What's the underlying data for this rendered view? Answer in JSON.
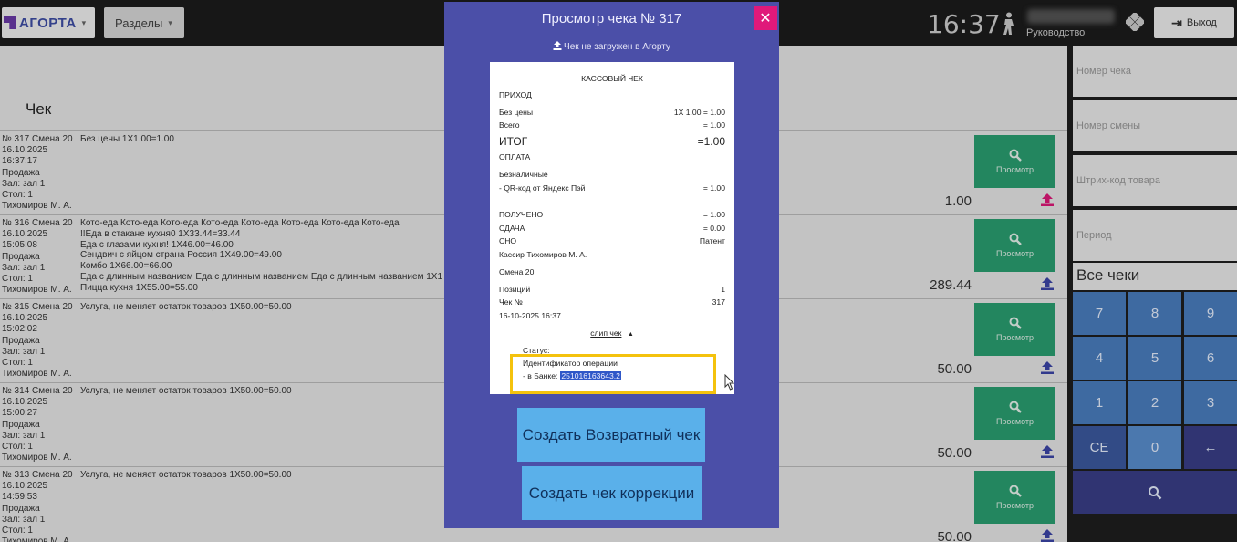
{
  "topbar": {
    "logo_text": "АГОРТА",
    "sections_label": "Разделы",
    "time": "16:37",
    "role": "Руководство",
    "exit_label": "Выход"
  },
  "page": {
    "title": "Чек"
  },
  "rows": [
    {
      "meta": "№ 317 Смена 20\n16.10.2025\n16:37:17\nПродажа\nЗал: зал 1\nСтол: 1\nТихомиров М. А.",
      "items": [
        "Без цены 1X1.00=1.00"
      ],
      "amount": "1.00",
      "view_label": "Просмотр",
      "upload_color": "#e0197a"
    },
    {
      "meta": "№ 316 Смена 20\n16.10.2025\n15:05:08\nПродажа\nЗал: зал 1\nСтол: 1\nТихомиров М. А.",
      "items": [
        "Кото-еда Кото-еда Кото-еда Кото-еда Кото-еда Кото-еда Кото-еда Кото-еда",
        "!!Еда в стакане кухня0 1X33.44=33.44",
        "Еда с глазами кухня! 1X46.00=46.00",
        "Сендвич с яйцом страна Россия 1X49.00=49.00",
        "Комбо 1X66.00=66.00",
        "Еда с длинным названием Еда с длинным названием Еда с длинным названием 1X1",
        "Пицца кухня 1X55.00=55.00"
      ],
      "amount": "289.44",
      "view_label": "Просмотр",
      "upload_color": "#3c46a8"
    },
    {
      "meta": "№ 315 Смена 20\n16.10.2025\n15:02:02\nПродажа\nЗал: зал 1\nСтол: 1\nТихомиров М. А.",
      "items": [
        "Услуга, не меняет остаток товаров 1X50.00=50.00"
      ],
      "amount": "50.00",
      "view_label": "Просмотр",
      "upload_color": "#3c46a8"
    },
    {
      "meta": "№ 314 Смена 20\n16.10.2025\n15:00:27\nПродажа\nЗал: зал 1\nСтол: 1\nТихомиров М. А.",
      "items": [
        "Услуга, не меняет остаток товаров 1X50.00=50.00"
      ],
      "amount": "50.00",
      "view_label": "Просмотр",
      "upload_color": "#3c46a8"
    },
    {
      "meta": "№ 313 Смена 20\n16.10.2025\n14:59:53\nПродажа\nЗал: зал 1\nСтол: 1\nТихомиров М. А.",
      "items": [
        "Услуга, не меняет остаток товаров 1X50.00=50.00"
      ],
      "amount": "50.00",
      "view_label": "Просмотр",
      "upload_color": "#3c46a8"
    }
  ],
  "filters": {
    "receipt_number": "Номер чека",
    "shift_number": "Номер смены",
    "barcode": "Штрих-код товара",
    "period": "Период",
    "all_checks": "Все чеки"
  },
  "keypad": {
    "keys": [
      "7",
      "8",
      "9",
      "4",
      "5",
      "6",
      "1",
      "2",
      "3",
      "CE",
      "0",
      "←"
    ]
  },
  "modal": {
    "title": "Просмотр чека № 317",
    "upload_status": "Чек не загружен в Агорту",
    "receipt": {
      "header": "КАССОВЫЙ ЧЕК",
      "type": "ПРИХОД",
      "item_name": "Без цены",
      "item_calc": "1X  1.00 =  1.00",
      "total_label": "Всего",
      "total_value": "=  1.00",
      "itog_label": "ИТОГ",
      "itog_value": "=1.00",
      "payment_label": "ОПЛАТА",
      "cashless_label": "Безналичные",
      "qr_label": "- QR-код от Яндекс Пэй",
      "qr_value": "=  1.00",
      "received_label": "ПОЛУЧЕНО",
      "received_value": "=  1.00",
      "change_label": "СДАЧА",
      "change_value": "=  0.00",
      "tax_label": "СНО",
      "tax_value": "Патент",
      "cashier": "Кассир Тихомиров М. А.",
      "shift": "Смена 20",
      "positions_label": "Позиций",
      "positions_value": "1",
      "check_no_label": "Чек №",
      "check_no_value": "317",
      "datetime": "16-10-2025 16:37",
      "slip_label": "слип чек",
      "status_label": "Статус:",
      "op_id_label": "Идентификатор операции",
      "bank_label": "- в Банке:",
      "bank_id": "251016163643.2"
    },
    "return_button": "Создать Возвратный чек",
    "correction_button": "Создать чек коррекции"
  },
  "colors": {
    "modal_bg": "#4b4fa8",
    "accent_green": "#2aa072",
    "close_pink": "#e0197a",
    "highlight_yellow": "#f4c20d",
    "action_blue": "#5ab0ea"
  }
}
